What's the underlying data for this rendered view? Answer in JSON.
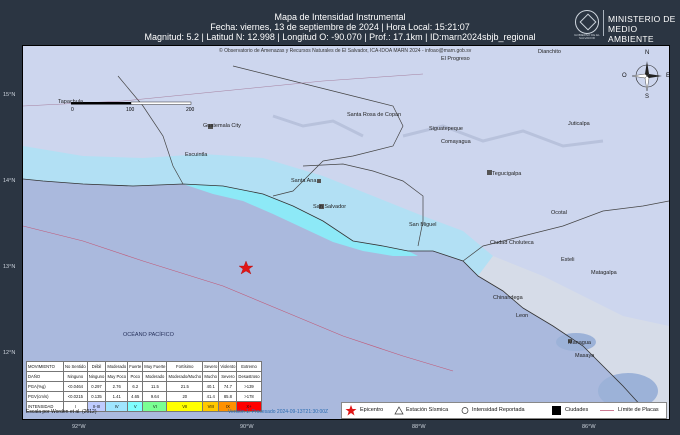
{
  "header": {
    "title": "Mapa de Intensidad Instrumental",
    "line2": "Fecha: viernes, 13 de septiembre de 2024 | Hora Local: 15:21:07",
    "line3": "Magnitud: 5.2 | Latitud N: 12.998 | Longitud O: -90.070 | Prof.: 17.1km | ID:marn2024sbjb_regional"
  },
  "logo": {
    "org_line1": "MINISTERIO DE",
    "org_line2": "MEDIO AMBIENTE",
    "seal_text": "GOBIERNO DE EL SALVADOR"
  },
  "map": {
    "credit": "© Observatorio de Amenazas y Recursos Naturales de El Salvador, ICA-IDOA MARN 2024 - infoao@marn.gob.sv",
    "scalebar": {
      "ticks": [
        "0",
        "100",
        "200"
      ],
      "unit": "km"
    },
    "compass": {
      "n": "N",
      "s": "S",
      "e": "E",
      "o": "O"
    },
    "ocean_label": "OCÉANO PACÍFICO",
    "lat_labels": [
      "15°N",
      "14°N",
      "13°N",
      "12°N"
    ],
    "lon_labels": [
      "92°W",
      "90°W",
      "88°W",
      "86°W"
    ],
    "places": [
      "Dianchito",
      "El Progreso",
      "Tapachula",
      "Guatemala City",
      "Santa Rosa de Copan",
      "Juticalpa",
      "Siguatepeque",
      "Escuintla",
      "Comayagua",
      "Tegucigalpa",
      "Santa Ana",
      "San Salvador",
      "San Miguel",
      "Ocotal",
      "Ciudad Choluteca",
      "Esteli",
      "Matagalpa",
      "Chinandega",
      "Leon",
      "Managua",
      "Masaya"
    ],
    "epicenter": {
      "lat": 12.998,
      "lon": -90.07
    }
  },
  "legend": {
    "rows": [
      {
        "label": "MOVIMIENTO",
        "cells": [
          "No Sentido",
          "Débil",
          "Moderado",
          "Fuerte",
          "Muy Fuerte",
          "Fortísimo",
          "Severo",
          "Violento",
          "Extremo"
        ]
      },
      {
        "label": "DAÑO",
        "cells": [
          "Ninguno",
          "Ninguno",
          "Muy Poco",
          "Poco",
          "Moderado",
          "Moderado/Mucho",
          "Mucho",
          "Severo",
          "Desastroso"
        ]
      },
      {
        "label": "PGA(%g)",
        "cells": [
          "<0.0464",
          "0.297",
          "2.76",
          "6.2",
          "11.5",
          "21.5",
          "40.1",
          "74.7",
          ">139"
        ]
      },
      {
        "label": "PGV(cm/s)",
        "cells": [
          "<0.0215",
          "0.135",
          "1.41",
          "4.65",
          "9.64",
          "20",
          "41.4",
          "85.8",
          ">178"
        ]
      },
      {
        "label": "INTENSIDAD",
        "cells": [
          "I",
          "II-III",
          "IV",
          "V",
          "VI",
          "VII",
          "VIII",
          "IX",
          "X+"
        ]
      }
    ],
    "intensity_colors": [
      "#ffffff",
      "#bfccff",
      "#a0e6ff",
      "#80ffff",
      "#7aff93",
      "#ffff00",
      "#ffc800",
      "#ff9100",
      "#ff0000"
    ],
    "scale_note": "Escala por Worden et al. (2012)",
    "version": "Versión 1: Procesado 2024-09-13T21:30:00Z"
  },
  "symbols": {
    "epicenter": "Epicentro",
    "station": "Estación Sísmica",
    "reported": "Intensidad Reportada",
    "cities": "Ciudades",
    "plates": "Límite de Placas"
  }
}
